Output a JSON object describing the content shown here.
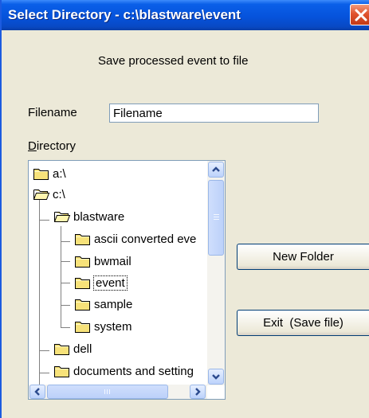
{
  "window": {
    "title": "Select Directory - c:\\blastware\\event"
  },
  "heading": "Save processed event to file",
  "filename": {
    "label": "Filename",
    "value": "Filename"
  },
  "directory": {
    "label_underlined": "D",
    "label_rest": "irectory",
    "tree": [
      {
        "name": "a:\\",
        "depth": 0,
        "open": false,
        "selected": false
      },
      {
        "name": "c:\\",
        "depth": 0,
        "open": true,
        "selected": false
      },
      {
        "name": "blastware",
        "depth": 1,
        "open": true,
        "selected": false
      },
      {
        "name": "ascii converted eve",
        "depth": 2,
        "open": false,
        "selected": false
      },
      {
        "name": "bwmail",
        "depth": 2,
        "open": false,
        "selected": false
      },
      {
        "name": "event",
        "depth": 2,
        "open": false,
        "selected": true
      },
      {
        "name": "sample",
        "depth": 2,
        "open": false,
        "selected": false
      },
      {
        "name": "system",
        "depth": 2,
        "open": false,
        "selected": false
      },
      {
        "name": "dell",
        "depth": 1,
        "open": false,
        "selected": false
      },
      {
        "name": "documents and setting",
        "depth": 1,
        "open": false,
        "selected": false
      }
    ]
  },
  "buttons": {
    "new_folder": "New Folder",
    "exit": "Exit  (Save file)"
  },
  "colors": {
    "titlebar": "#0653dc",
    "close": "#e0532e",
    "folder": "#f7e27a",
    "dialog": "#ece9d8"
  }
}
